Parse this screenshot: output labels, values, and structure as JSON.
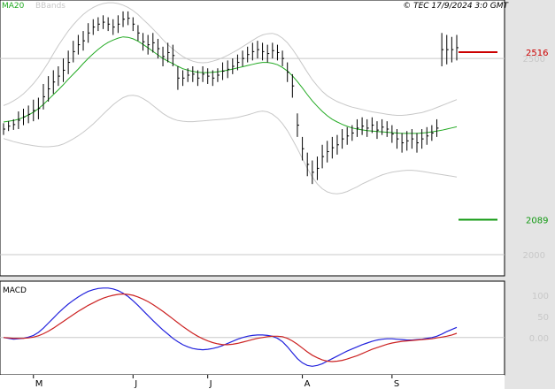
{
  "header": {
    "legend_ma": "MA20",
    "legend_bb": "BBands",
    "copyright": "© TEC 17/9/2024 3:0 GMT"
  },
  "colors": {
    "price": "#000000",
    "ma": "#22aa22",
    "bbands": "#c8c8c8",
    "resistance": "#cc0000",
    "support": "#119911",
    "macd": "#2222dd",
    "signal": "#cc2222",
    "panel_bg": "#ffffff",
    "outer_bg": "#e4e4e4"
  },
  "chart_data": [
    {
      "type": "line",
      "panel": "price",
      "title": "",
      "series_names": [
        "MA20",
        "BBands"
      ],
      "y_ticks": [
        {
          "value": 2500,
          "label": "2500"
        },
        {
          "value": 2000,
          "label": "2000"
        }
      ],
      "ylim": [
        1955,
        2640
      ],
      "x_ticks": [
        {
          "index": 6,
          "label": "M"
        },
        {
          "index": 26,
          "label": "J"
        },
        {
          "index": 41,
          "label": "J"
        },
        {
          "index": 60,
          "label": "A"
        },
        {
          "index": 78,
          "label": "S"
        }
      ],
      "x_count": 92,
      "levels": [
        {
          "name": "resistance",
          "value": 2516,
          "label": "2516"
        },
        {
          "name": "support",
          "value": 2089,
          "label": "2089"
        }
      ],
      "ohlc_hl": [
        [
          2305,
          2335
        ],
        [
          2315,
          2340
        ],
        [
          2318,
          2345
        ],
        [
          2320,
          2365
        ],
        [
          2330,
          2372
        ],
        [
          2335,
          2380
        ],
        [
          2340,
          2395
        ],
        [
          2345,
          2400
        ],
        [
          2370,
          2435
        ],
        [
          2390,
          2455
        ],
        [
          2410,
          2470
        ],
        [
          2430,
          2480
        ],
        [
          2440,
          2500
        ],
        [
          2460,
          2520
        ],
        [
          2490,
          2545
        ],
        [
          2510,
          2560
        ],
        [
          2520,
          2570
        ],
        [
          2540,
          2590
        ],
        [
          2560,
          2600
        ],
        [
          2570,
          2605
        ],
        [
          2575,
          2610
        ],
        [
          2570,
          2605
        ],
        [
          2560,
          2600
        ],
        [
          2565,
          2610
        ],
        [
          2580,
          2620
        ],
        [
          2585,
          2620
        ],
        [
          2570,
          2605
        ],
        [
          2545,
          2585
        ],
        [
          2520,
          2565
        ],
        [
          2510,
          2560
        ],
        [
          2515,
          2565
        ],
        [
          2500,
          2550
        ],
        [
          2480,
          2530
        ],
        [
          2490,
          2540
        ],
        [
          2480,
          2535
        ],
        [
          2420,
          2480
        ],
        [
          2430,
          2470
        ],
        [
          2440,
          2475
        ],
        [
          2440,
          2480
        ],
        [
          2430,
          2470
        ],
        [
          2440,
          2480
        ],
        [
          2435,
          2475
        ],
        [
          2430,
          2470
        ],
        [
          2440,
          2475
        ],
        [
          2445,
          2490
        ],
        [
          2450,
          2495
        ],
        [
          2460,
          2500
        ],
        [
          2470,
          2510
        ],
        [
          2480,
          2520
        ],
        [
          2490,
          2530
        ],
        [
          2495,
          2540
        ],
        [
          2500,
          2545
        ],
        [
          2495,
          2540
        ],
        [
          2490,
          2535
        ],
        [
          2500,
          2540
        ],
        [
          2495,
          2535
        ],
        [
          2480,
          2520
        ],
        [
          2440,
          2490
        ],
        [
          2400,
          2460
        ],
        [
          2300,
          2360
        ],
        [
          2240,
          2300
        ],
        [
          2200,
          2260
        ],
        [
          2180,
          2240
        ],
        [
          2190,
          2250
        ],
        [
          2220,
          2280
        ],
        [
          2235,
          2290
        ],
        [
          2245,
          2300
        ],
        [
          2255,
          2305
        ],
        [
          2270,
          2320
        ],
        [
          2280,
          2325
        ],
        [
          2290,
          2330
        ],
        [
          2300,
          2345
        ],
        [
          2305,
          2350
        ],
        [
          2300,
          2345
        ],
        [
          2310,
          2350
        ],
        [
          2295,
          2340
        ],
        [
          2305,
          2345
        ],
        [
          2300,
          2340
        ],
        [
          2285,
          2330
        ],
        [
          2270,
          2320
        ],
        [
          2260,
          2310
        ],
        [
          2265,
          2315
        ],
        [
          2270,
          2320
        ],
        [
          2260,
          2310
        ],
        [
          2270,
          2320
        ],
        [
          2280,
          2325
        ],
        [
          2290,
          2330
        ],
        [
          2300,
          2345
        ],
        [
          2480,
          2565
        ],
        [
          2485,
          2560
        ],
        [
          2490,
          2555
        ],
        [
          2495,
          2560
        ]
      ],
      "ma20": [
        2338,
        2340,
        2342,
        2345,
        2350,
        2356,
        2363,
        2372,
        2383,
        2395,
        2408,
        2420,
        2433,
        2447,
        2460,
        2473,
        2487,
        2500,
        2512,
        2523,
        2533,
        2541,
        2547,
        2552,
        2555,
        2554,
        2550,
        2544,
        2536,
        2527,
        2518,
        2509,
        2500,
        2493,
        2487,
        2480,
        2474,
        2470,
        2467,
        2465,
        2464,
        2464,
        2465,
        2466,
        2468,
        2470,
        2473,
        2476,
        2479,
        2482,
        2485,
        2488,
        2490,
        2490,
        2488,
        2484,
        2477,
        2468,
        2456,
        2441,
        2425,
        2408,
        2392,
        2378,
        2365,
        2354,
        2345,
        2338,
        2332,
        2327,
        2323,
        2320,
        2318,
        2316,
        2315,
        2314,
        2313,
        2312,
        2311,
        2310,
        2309,
        2309,
        2309,
        2309,
        2310,
        2311,
        2313,
        2315,
        2317,
        2320,
        2323,
        2326
      ],
      "bb_upper": [
        2380,
        2385,
        2392,
        2400,
        2410,
        2422,
        2436,
        2452,
        2470,
        2490,
        2512,
        2533,
        2552,
        2570,
        2586,
        2600,
        2612,
        2622,
        2630,
        2636,
        2640,
        2642,
        2642,
        2640,
        2636,
        2630,
        2622,
        2612,
        2600,
        2588,
        2575,
        2562,
        2548,
        2535,
        2524,
        2514,
        2505,
        2498,
        2493,
        2490,
        2489,
        2490,
        2493,
        2497,
        2502,
        2508,
        2515,
        2522,
        2530,
        2538,
        2546,
        2554,
        2560,
        2563,
        2564,
        2560,
        2552,
        2540,
        2524,
        2505,
        2485,
        2465,
        2446,
        2430,
        2416,
        2405,
        2397,
        2390,
        2385,
        2380,
        2376,
        2373,
        2370,
        2367,
        2364,
        2362,
        2360,
        2358,
        2356,
        2355,
        2355,
        2356,
        2358,
        2360,
        2362,
        2366,
        2370,
        2375,
        2380,
        2385,
        2390,
        2395
      ],
      "bb_lower": [
        2296,
        2292,
        2288,
        2285,
        2282,
        2280,
        2278,
        2276,
        2275,
        2275,
        2276,
        2278,
        2282,
        2288,
        2295,
        2303,
        2312,
        2322,
        2333,
        2345,
        2358,
        2370,
        2382,
        2392,
        2400,
        2405,
        2406,
        2404,
        2398,
        2390,
        2380,
        2370,
        2360,
        2352,
        2346,
        2342,
        2340,
        2339,
        2339,
        2340,
        2341,
        2342,
        2343,
        2344,
        2345,
        2346,
        2348,
        2350,
        2353,
        2356,
        2360,
        2364,
        2366,
        2364,
        2358,
        2348,
        2334,
        2316,
        2294,
        2270,
        2245,
        2220,
        2198,
        2180,
        2168,
        2160,
        2156,
        2155,
        2157,
        2161,
        2167,
        2173,
        2180,
        2186,
        2192,
        2198,
        2203,
        2207,
        2210,
        2212,
        2214,
        2215,
        2215,
        2214,
        2212,
        2210,
        2208,
        2206,
        2204,
        2202,
        2200,
        2198
      ]
    },
    {
      "type": "line",
      "panel": "macd",
      "title": "MACD",
      "series_names": [],
      "y_ticks": [
        {
          "value": 100,
          "label": "100"
        },
        {
          "value": 50,
          "label": "50"
        },
        {
          "value": 0,
          "label": "0.00"
        }
      ],
      "ylim": [
        -80,
        125
      ],
      "macd": [
        0,
        -2,
        -4,
        -3,
        -2,
        1,
        5,
        12,
        22,
        34,
        46,
        58,
        69,
        79,
        88,
        96,
        103,
        109,
        113,
        116,
        117,
        117,
        115,
        111,
        105,
        97,
        87,
        76,
        64,
        52,
        40,
        29,
        18,
        8,
        -2,
        -10,
        -17,
        -22,
        -26,
        -28,
        -29,
        -28,
        -26,
        -23,
        -19,
        -14,
        -9,
        -4,
        0,
        3,
        5,
        6,
        6,
        5,
        3,
        -2,
        -10,
        -22,
        -36,
        -50,
        -60,
        -66,
        -68,
        -66,
        -62,
        -56,
        -50,
        -44,
        -38,
        -32,
        -27,
        -22,
        -17,
        -13,
        -9,
        -6,
        -4,
        -3,
        -3,
        -4,
        -5,
        -6,
        -6,
        -5,
        -4,
        -2,
        0,
        3,
        8,
        14,
        19,
        24
      ],
      "signal": [
        0,
        -1,
        -2,
        -2,
        -2,
        -1,
        1,
        4,
        9,
        15,
        22,
        30,
        38,
        46,
        54,
        62,
        69,
        76,
        82,
        88,
        93,
        97,
        100,
        102,
        103,
        102,
        100,
        96,
        91,
        85,
        78,
        70,
        62,
        53,
        44,
        35,
        26,
        18,
        10,
        3,
        -3,
        -8,
        -12,
        -15,
        -17,
        -17,
        -16,
        -14,
        -11,
        -8,
        -5,
        -2,
        0,
        2,
        3,
        3,
        2,
        -2,
        -8,
        -16,
        -25,
        -34,
        -42,
        -48,
        -53,
        -56,
        -57,
        -56,
        -54,
        -51,
        -47,
        -43,
        -38,
        -33,
        -28,
        -24,
        -20,
        -16,
        -13,
        -11,
        -9,
        -8,
        -7,
        -6,
        -5,
        -4,
        -3,
        -1,
        1,
        3,
        6,
        10
      ]
    }
  ]
}
